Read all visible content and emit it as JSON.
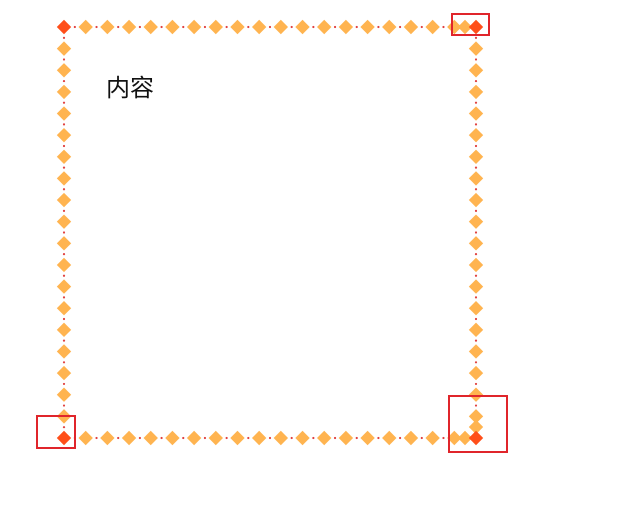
{
  "content": {
    "text": "内容"
  },
  "border": {
    "style": "diamond-dotted",
    "diamond_color": "#ffb450",
    "corner_diamond_color": "#ff4f1a",
    "dot_color": "#e04040",
    "highlight_color": "#e0252b"
  }
}
